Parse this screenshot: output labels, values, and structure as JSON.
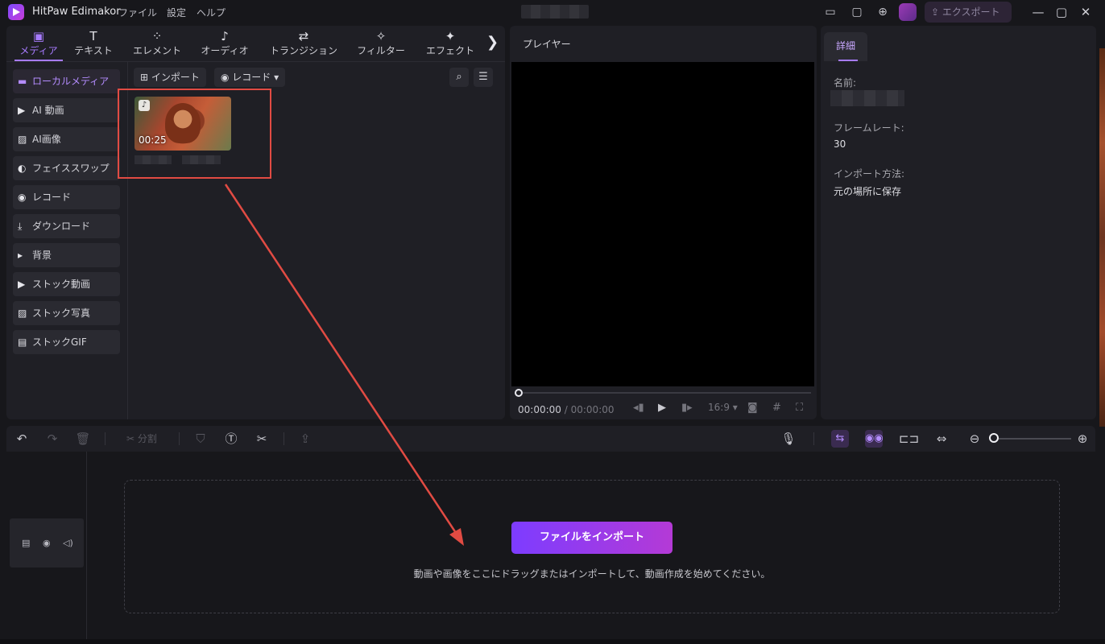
{
  "app": {
    "title": "HitPaw Edimakor",
    "menu": [
      "ファイル",
      "設定",
      "ヘルプ"
    ],
    "export_label": "エクスポート"
  },
  "toolbar_tabs": [
    {
      "label": "メディア",
      "icon": "media-icon",
      "glyph": "▣",
      "active": true
    },
    {
      "label": "テキスト",
      "icon": "text-icon",
      "glyph": "T",
      "active": false
    },
    {
      "label": "エレメント",
      "icon": "element-icon",
      "glyph": "⁘",
      "active": false
    },
    {
      "label": "オーディオ",
      "icon": "audio-icon",
      "glyph": "♪",
      "active": false
    },
    {
      "label": "トランジション",
      "icon": "transition-icon",
      "glyph": "⇄",
      "active": false
    },
    {
      "label": "フィルター",
      "icon": "filter-icon",
      "glyph": "✧",
      "active": false
    },
    {
      "label": "エフェクト",
      "icon": "effect-icon",
      "glyph": "✦",
      "active": false
    }
  ],
  "sidebar": {
    "items": [
      {
        "label": "ローカルメディア",
        "icon": "folder-icon",
        "glyph": "▬",
        "active": true
      },
      {
        "label": "AI 動画",
        "icon": "ai-video-icon",
        "glyph": "▶",
        "active": false
      },
      {
        "label": "AI画像",
        "icon": "ai-image-icon",
        "glyph": "▨",
        "active": false
      },
      {
        "label": "フェイススワップ",
        "icon": "face-swap-icon",
        "glyph": "◐",
        "active": false
      },
      {
        "label": "レコード",
        "icon": "record-icon",
        "glyph": "◉",
        "active": false
      },
      {
        "label": "ダウンロード",
        "icon": "download-icon",
        "glyph": "⤓",
        "active": false
      },
      {
        "label": "背景",
        "icon": "caret-right-icon",
        "glyph": "▸",
        "active": false
      },
      {
        "label": "ストック動画",
        "icon": "stock-video-icon",
        "glyph": "▶",
        "active": false
      },
      {
        "label": "ストック写真",
        "icon": "stock-photo-icon",
        "glyph": "▨",
        "active": false
      },
      {
        "label": "ストックGIF",
        "icon": "stock-gif-icon",
        "glyph": "▤",
        "active": false
      }
    ]
  },
  "media": {
    "import_label": "インポート",
    "record_label": "レコード",
    "clip_duration": "00:25",
    "clip_badge": "♪"
  },
  "player": {
    "title": "プレイヤー",
    "current_time": "00:00:00",
    "separator": "/",
    "total_time": "00:00:00",
    "aspect": "16:9"
  },
  "details": {
    "tab_label": "詳細",
    "name_label": "名前:",
    "framerate_label": "フレームレート:",
    "framerate_value": "30",
    "import_method_label": "インポート方法:",
    "import_method_value": "元の場所に保存"
  },
  "timeline": {
    "split_label": "分割",
    "import_button": "ファイルをインポート",
    "drop_hint": "動画や画像をここにドラッグまたはインポートして、動画作成を始めてください。"
  },
  "colors": {
    "accent": "#a77bff",
    "annotation_red": "#e14b43",
    "import_gradient_start": "#7d3cff",
    "import_gradient_end": "#b43ad6"
  }
}
